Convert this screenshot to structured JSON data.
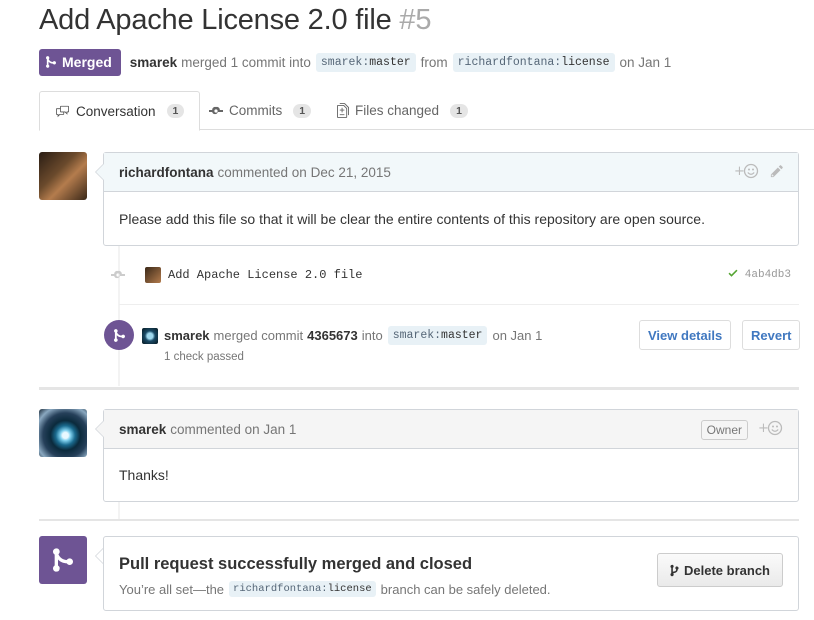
{
  "pr": {
    "title": "Add Apache License 2.0 file",
    "number": "#5",
    "state": "Merged",
    "author": "smarek",
    "merge_text": "merged 1 commit into",
    "base_user": "smarek",
    "base_branch": "master",
    "from_text": "from",
    "head_user": "richardfontana",
    "head_branch": "license",
    "date_text": "on Jan 1"
  },
  "tabs": [
    {
      "label": "Conversation",
      "count": "1",
      "icon": "comment-discussion-icon"
    },
    {
      "label": "Commits",
      "count": "1",
      "icon": "git-commit-icon"
    },
    {
      "label": "Files changed",
      "count": "1",
      "icon": "diff-icon"
    }
  ],
  "comment1": {
    "author": "richardfontana",
    "meta": "commented on Dec 21, 2015",
    "body": "Please add this file so that it will be clear the entire contents of this repository are open source."
  },
  "commit": {
    "message": "Add Apache License 2.0 file",
    "sha": "4ab4db3",
    "status": "success"
  },
  "merge_event": {
    "author": "smarek",
    "text_before": "merged commit",
    "sha": "4365673",
    "text_into": "into",
    "ref_user": "smarek",
    "ref_branch": "master",
    "date": "on Jan 1",
    "checks": "1 check passed",
    "view_details": "View details",
    "revert": "Revert"
  },
  "comment2": {
    "author": "smarek",
    "meta": "commented on Jan 1",
    "badge": "Owner",
    "body": "Thanks!"
  },
  "merge_box": {
    "title": "Pull request successfully merged and closed",
    "msg_before": "You’re all set—the",
    "ref_user": "richardfontana",
    "ref_branch": "license",
    "msg_after": "branch can be safely deleted.",
    "delete_button": "Delete branch"
  },
  "colors": {
    "merged": "#6e5494",
    "link": "#4078c0",
    "success": "#55a532"
  }
}
